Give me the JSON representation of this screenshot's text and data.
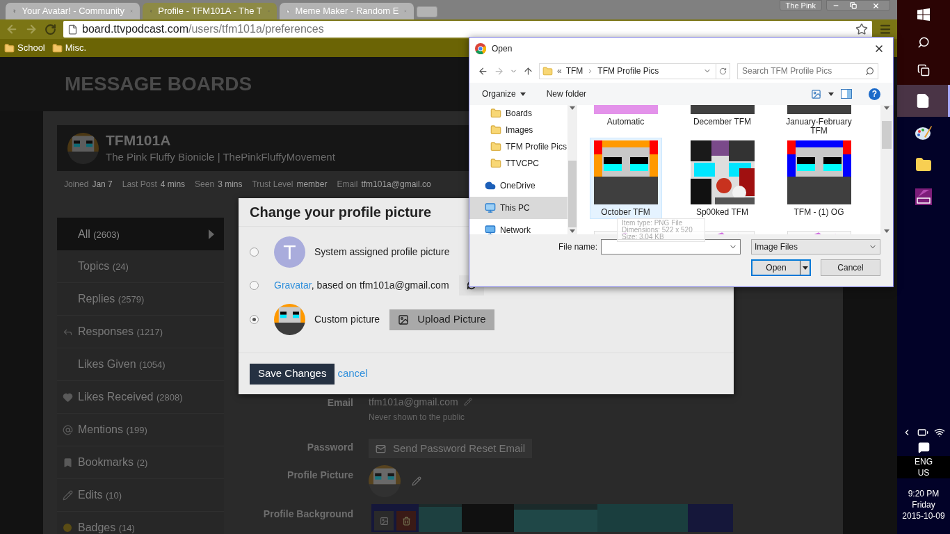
{
  "browser": {
    "tabs": [
      {
        "title": "Your Avatar! - Community",
        "kind": "site",
        "selected": false
      },
      {
        "title": "Profile - TFM101A - The T",
        "kind": "site",
        "selected": true
      },
      {
        "title": "Meme Maker - Random E",
        "kind": "page",
        "selected": false
      }
    ],
    "profile": "The Pink",
    "url": {
      "host": "board.ttvpodcast.com",
      "path": "/users/tfm101a/preferences"
    },
    "bookmarks": [
      "School",
      "Misc."
    ]
  },
  "page": {
    "site_title": "MESSAGE BOARDS",
    "user": {
      "username": "TFM101A",
      "tagline": "The Pink Fluffy Bionicle | ThePinkFluffyMovement"
    },
    "stats": [
      {
        "label": "Joined",
        "value": "Jan 7"
      },
      {
        "label": "Last Post",
        "value": "4 mins"
      },
      {
        "label": "Seen",
        "value": "3 mins"
      },
      {
        "label": "Trust Level",
        "value": "member"
      },
      {
        "label": "Email",
        "value": "tfm101a@gmail.co"
      }
    ],
    "sidebar": [
      {
        "label": "All",
        "count": "(2603)",
        "kind": "plain",
        "selected": true
      },
      {
        "label": "Topics",
        "count": "(24)",
        "kind": "plain",
        "selected": false
      },
      {
        "label": "Replies",
        "count": "(2579)",
        "kind": "plain",
        "selected": false
      },
      {
        "label": "Responses",
        "count": "(1217)",
        "kind": "reply",
        "selected": false
      },
      {
        "label": "Likes Given",
        "count": "(1054)",
        "kind": "plain",
        "selected": false
      },
      {
        "label": "Likes Received",
        "count": "(2808)",
        "kind": "heart",
        "selected": false
      },
      {
        "label": "Mentions",
        "count": "(199)",
        "kind": "at",
        "selected": false
      },
      {
        "label": "Bookmarks",
        "count": "(2)",
        "kind": "bookmark",
        "selected": false
      },
      {
        "label": "Edits",
        "count": "(10)",
        "kind": "pencil",
        "selected": false
      },
      {
        "label": "Badges",
        "count": "(14)",
        "kind": "badge",
        "selected": false
      }
    ],
    "settings": {
      "email_label": "Email",
      "email": "tfm101a@gmail.com",
      "email_note": "Never shown to the public",
      "password_label": "Password",
      "password_button": "Send Password Reset Email",
      "picture_label": "Profile Picture",
      "background_label": "Profile Background"
    }
  },
  "modal": {
    "title": "Change your profile picture",
    "options": [
      {
        "kind": "system",
        "letter": "T",
        "label": "System assigned profile picture",
        "selected": false
      },
      {
        "kind": "gravatar",
        "link": "Gravatar",
        "label": ", based on tfm101a@gmail.com",
        "selected": false
      },
      {
        "kind": "custom",
        "label": "Custom picture",
        "button": "Upload Picture",
        "selected": true
      }
    ],
    "save": "Save Changes",
    "cancel": "cancel"
  },
  "file_dialog": {
    "title": "Open",
    "path_prefix": "«",
    "path": [
      "TFM",
      "TFM Profile Pics"
    ],
    "search_placeholder": "Search TFM Profile Pics",
    "organize": "Organize",
    "new_folder": "New folder",
    "help": "?",
    "nav": [
      {
        "label": "Boards",
        "kind": "folder",
        "selected": false
      },
      {
        "label": "Images",
        "kind": "folder",
        "selected": false
      },
      {
        "label": "TFM Profile Pics",
        "kind": "folder",
        "selected": false
      },
      {
        "label": "TTVCPC",
        "kind": "folder",
        "selected": false
      },
      {
        "label": "OneDrive",
        "kind": "cloud",
        "selected": false
      },
      {
        "label": "This PC",
        "kind": "pc",
        "selected": true
      },
      {
        "label": "Network",
        "kind": "network",
        "selected": false
      }
    ],
    "files": [
      {
        "name": "Automatic",
        "selected": false
      },
      {
        "name": "December TFM",
        "selected": false
      },
      {
        "name": "January-February TFM",
        "selected": false
      },
      {
        "name": "October TFM",
        "selected": true
      },
      {
        "name": "Sp00ked TFM",
        "selected": false
      },
      {
        "name": "TFM - (1) OG",
        "selected": false
      },
      {
        "kind": "picture"
      },
      {
        "kind": "picture"
      },
      {
        "kind": "picture"
      }
    ],
    "tooltip": [
      "Item type: PNG File",
      "Dimensions: 522 x 520",
      "Size: 3.04 KB"
    ],
    "file_name_label": "File name:",
    "filter": "Image Files",
    "open": "Open",
    "cancel": "Cancel"
  },
  "taskbar": {
    "apps": [
      {
        "kind": "file",
        "selected": true
      },
      {
        "kind": "paint",
        "selected": false
      },
      {
        "kind": "folder",
        "selected": false
      },
      {
        "kind": "pdf",
        "selected": false
      }
    ],
    "language": [
      "ENG",
      "US"
    ],
    "time": "9:20 PM",
    "day": "Friday",
    "date": "2015-10-09"
  }
}
